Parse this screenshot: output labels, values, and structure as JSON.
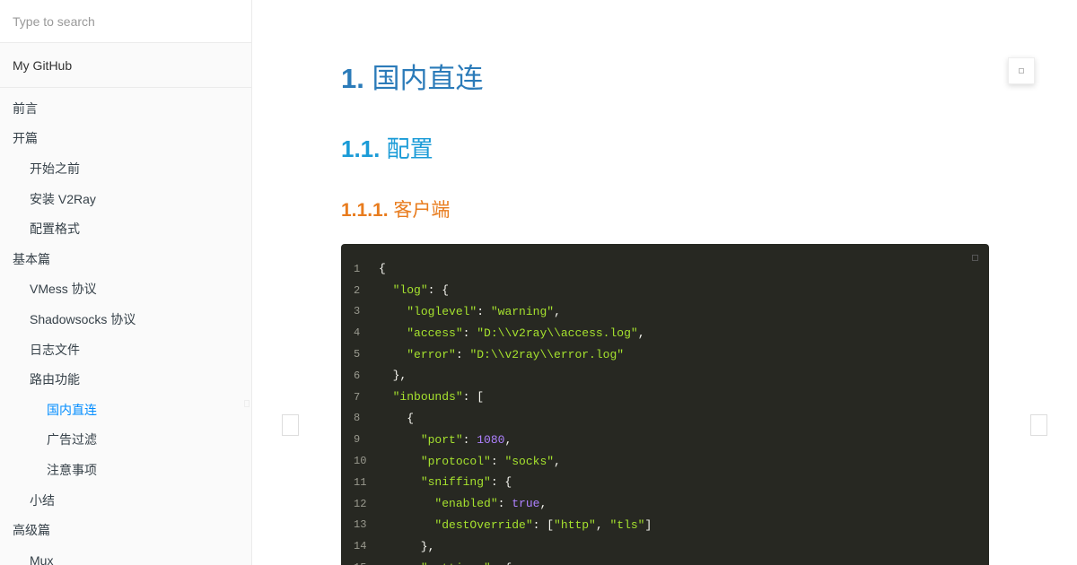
{
  "sidebar": {
    "search_placeholder": "Type to search",
    "github_label": "My GitHub",
    "items": [
      {
        "label": "前言",
        "level": 0
      },
      {
        "label": "开篇",
        "level": 0
      },
      {
        "label": "开始之前",
        "level": 1
      },
      {
        "label": "安装 V2Ray",
        "level": 1
      },
      {
        "label": "配置格式",
        "level": 1
      },
      {
        "label": "基本篇",
        "level": 0
      },
      {
        "label": "VMess 协议",
        "level": 1
      },
      {
        "label": "Shadowsocks 协议",
        "level": 1
      },
      {
        "label": "日志文件",
        "level": 1
      },
      {
        "label": "路由功能",
        "level": 1
      },
      {
        "label": "国内直连",
        "level": 2,
        "active": true
      },
      {
        "label": "广告过滤",
        "level": 2
      },
      {
        "label": "注意事项",
        "level": 2
      },
      {
        "label": "小结",
        "level": 1
      },
      {
        "label": "高级篇",
        "level": 0
      },
      {
        "label": "Mux",
        "level": 1
      }
    ]
  },
  "content": {
    "h1": {
      "num": "1.",
      "text": "国内直连"
    },
    "h2": {
      "num": "1.1.",
      "text": "配置"
    },
    "h3": {
      "num": "1.1.1.",
      "text": "客户端"
    },
    "code_lines": [
      [
        [
          "p",
          "{"
        ]
      ],
      [
        [
          "p",
          "  "
        ],
        [
          "k",
          "\"log\""
        ],
        [
          "p",
          ": {"
        ]
      ],
      [
        [
          "p",
          "    "
        ],
        [
          "k",
          "\"loglevel\""
        ],
        [
          "p",
          ": "
        ],
        [
          "s",
          "\"warning\""
        ],
        [
          "p",
          ","
        ]
      ],
      [
        [
          "p",
          "    "
        ],
        [
          "k",
          "\"access\""
        ],
        [
          "p",
          ": "
        ],
        [
          "s",
          "\"D:\\\\v2ray\\\\access.log\""
        ],
        [
          "p",
          ","
        ]
      ],
      [
        [
          "p",
          "    "
        ],
        [
          "k",
          "\"error\""
        ],
        [
          "p",
          ": "
        ],
        [
          "s",
          "\"D:\\\\v2ray\\\\error.log\""
        ]
      ],
      [
        [
          "p",
          "  },"
        ]
      ],
      [
        [
          "p",
          "  "
        ],
        [
          "k",
          "\"inbounds\""
        ],
        [
          "p",
          ": ["
        ]
      ],
      [
        [
          "p",
          "    {"
        ]
      ],
      [
        [
          "p",
          "      "
        ],
        [
          "k",
          "\"port\""
        ],
        [
          "p",
          ": "
        ],
        [
          "n",
          "1080"
        ],
        [
          "p",
          ","
        ]
      ],
      [
        [
          "p",
          "      "
        ],
        [
          "k",
          "\"protocol\""
        ],
        [
          "p",
          ": "
        ],
        [
          "s",
          "\"socks\""
        ],
        [
          "p",
          ","
        ]
      ],
      [
        [
          "p",
          "      "
        ],
        [
          "k",
          "\"sniffing\""
        ],
        [
          "p",
          ": {"
        ]
      ],
      [
        [
          "p",
          "        "
        ],
        [
          "k",
          "\"enabled\""
        ],
        [
          "p",
          ": "
        ],
        [
          "n",
          "true"
        ],
        [
          "p",
          ","
        ]
      ],
      [
        [
          "p",
          "        "
        ],
        [
          "k",
          "\"destOverride\""
        ],
        [
          "p",
          ": ["
        ],
        [
          "s",
          "\"http\""
        ],
        [
          "p",
          ", "
        ],
        [
          "s",
          "\"tls\""
        ],
        [
          "p",
          "]"
        ]
      ],
      [
        [
          "p",
          "      },"
        ]
      ],
      [
        [
          "p",
          "      "
        ],
        [
          "k",
          "\"settings\""
        ],
        [
          "p",
          ": {"
        ]
      ]
    ]
  },
  "colors": {
    "h1": "#2b7bb9",
    "h2": "#1a9bd7",
    "h3": "#e87c1e",
    "active_nav": "#008cff",
    "code_bg": "#272822"
  }
}
